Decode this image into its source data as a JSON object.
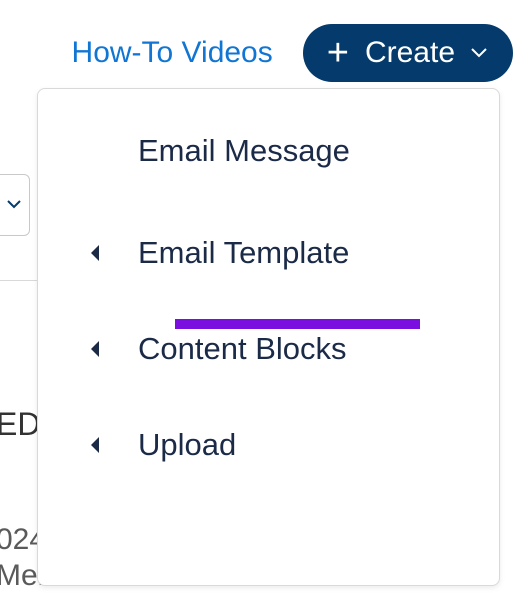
{
  "toolbar": {
    "howto_label": "How-To Videos",
    "create_label": "Create"
  },
  "dropdown": {
    "items": [
      {
        "label": "Email Message",
        "has_submenu": false
      },
      {
        "label": "Email Template",
        "has_submenu": true,
        "highlighted": true
      },
      {
        "label": "Content Blocks",
        "has_submenu": true
      },
      {
        "label": "Upload",
        "has_submenu": true
      }
    ]
  },
  "background": {
    "partial_ed": "ED",
    "partial_year": "024",
    "partial_merchant": "Merchant"
  },
  "colors": {
    "link": "#1176d3",
    "button_bg": "#043b6c",
    "text_dark": "#1b2a47",
    "highlight": "#7a0fe0"
  }
}
